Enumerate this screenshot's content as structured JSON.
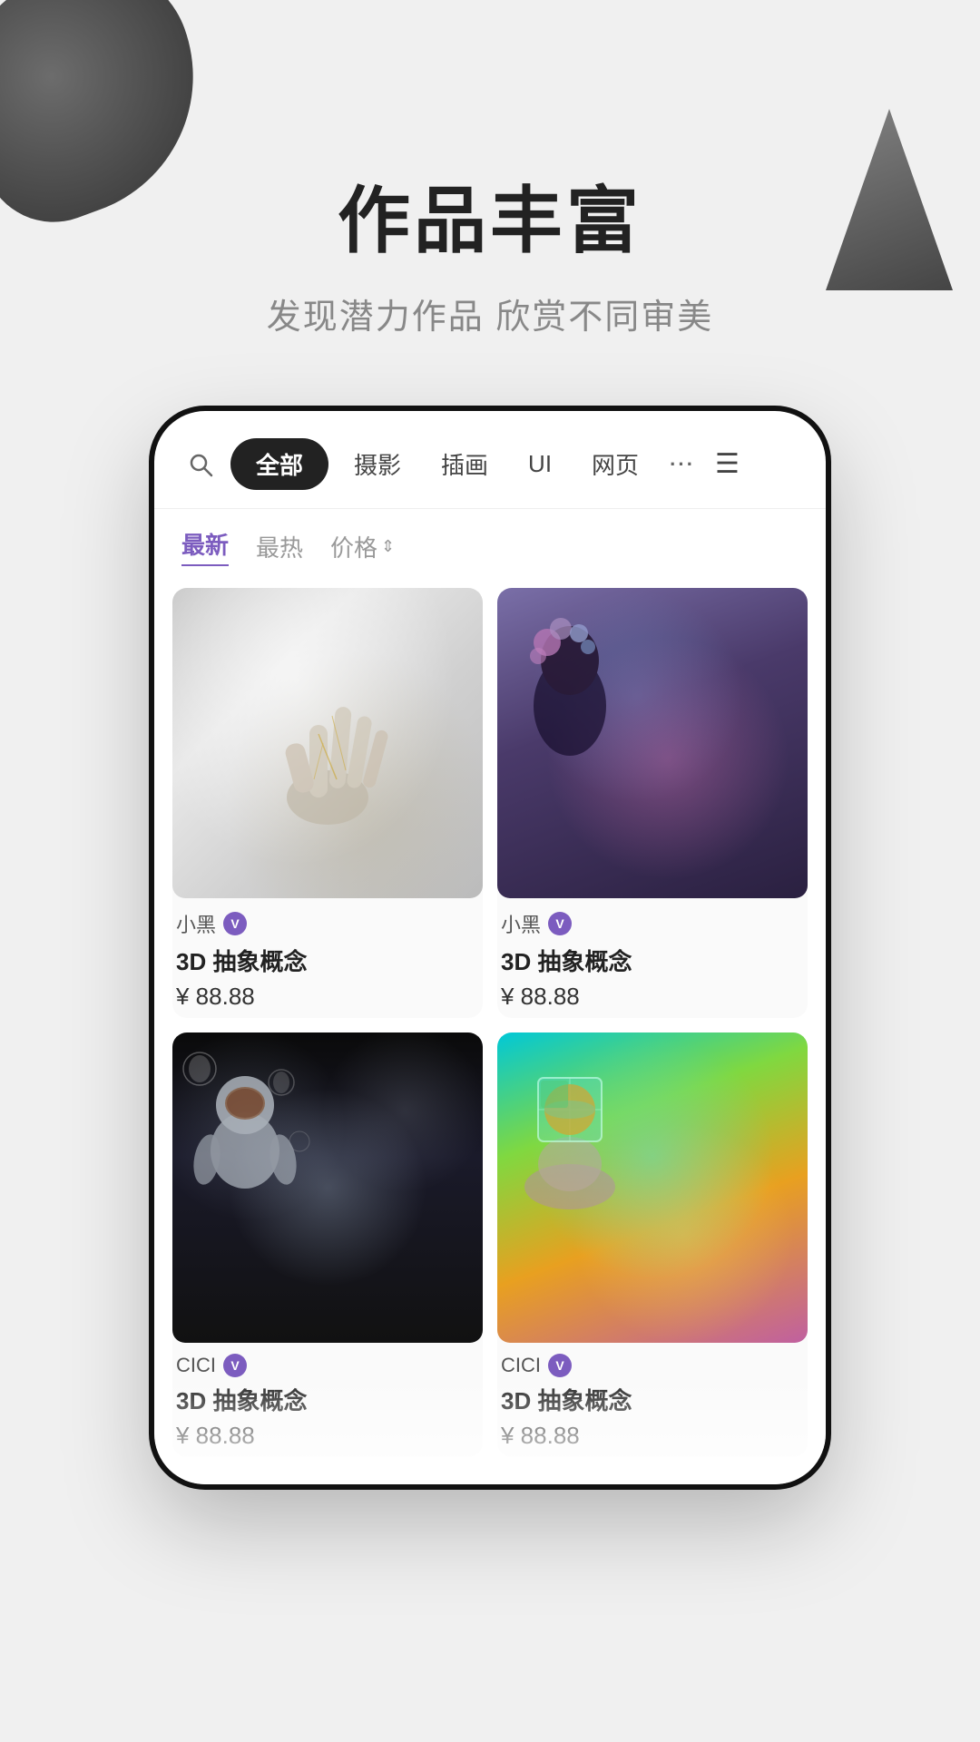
{
  "page": {
    "background_color": "#efefef"
  },
  "headline": {
    "title": "作品丰富",
    "subtitle": "发现潜力作品  欣赏不同审美"
  },
  "phone": {
    "nav": {
      "search_placeholder": "搜索",
      "tabs": [
        {
          "label": "全部",
          "active": true
        },
        {
          "label": "摄影",
          "active": false
        },
        {
          "label": "插画",
          "active": false
        },
        {
          "label": "UI",
          "active": false
        },
        {
          "label": "网页",
          "active": false
        }
      ],
      "more_icon": "···",
      "menu_icon": "☰"
    },
    "filters": [
      {
        "label": "最新",
        "active": true
      },
      {
        "label": "最热",
        "active": false
      },
      {
        "label": "价格",
        "active": false,
        "has_arrow": true
      }
    ],
    "products": [
      {
        "id": 1,
        "image_type": "hand",
        "author": "小黑",
        "verified": true,
        "title": "3D 抽象概念",
        "price": "¥ 88.88"
      },
      {
        "id": 2,
        "image_type": "head",
        "author": "小黑",
        "verified": true,
        "title": "3D 抽象概念",
        "price": "¥ 88.88"
      },
      {
        "id": 3,
        "image_type": "astronaut",
        "author": "CICI",
        "verified": true,
        "title": "3D 抽象概念",
        "price": "¥ 88.88"
      },
      {
        "id": 4,
        "image_type": "cube",
        "author": "CICI",
        "verified": true,
        "title": "3D 抽象概念",
        "price": "¥ 88.88"
      }
    ]
  }
}
